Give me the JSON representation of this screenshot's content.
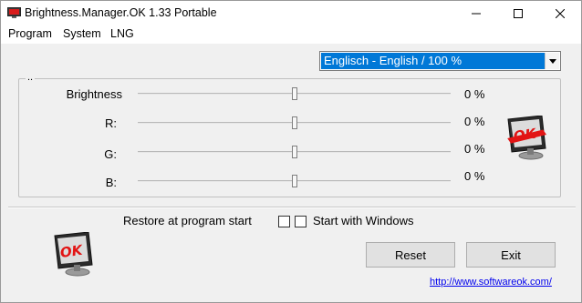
{
  "window": {
    "title": "Brightness.Manager.OK 1.33 Portable",
    "icon": "brightness-manager-app-icon"
  },
  "titlebar_controls": [
    "minimize-icon",
    "maximize-icon",
    "close-icon"
  ],
  "menu": {
    "items": [
      "Program",
      "System",
      "LNG"
    ]
  },
  "language_select": {
    "selected": "Englisch - English / 100 %"
  },
  "group": {
    "caption": "..",
    "rows": [
      {
        "label": "Brightness",
        "value": "0 %",
        "level_percent": 50
      },
      {
        "label": "R:",
        "value": "0 %",
        "level_percent": 50
      },
      {
        "label": "G:",
        "value": "0 %",
        "level_percent": 50
      },
      {
        "label": "B:",
        "value": "0 %",
        "level_percent": 50
      }
    ]
  },
  "options": {
    "restore_label": "Restore at program start",
    "restore_checked": false,
    "start_label": "Start with Windows",
    "start_checked": false
  },
  "buttons": {
    "reset": "Reset",
    "exit": "Exit"
  },
  "link": "http://www.softwareok.com/",
  "logos": {
    "text": "OK",
    "color": "#e21414"
  }
}
